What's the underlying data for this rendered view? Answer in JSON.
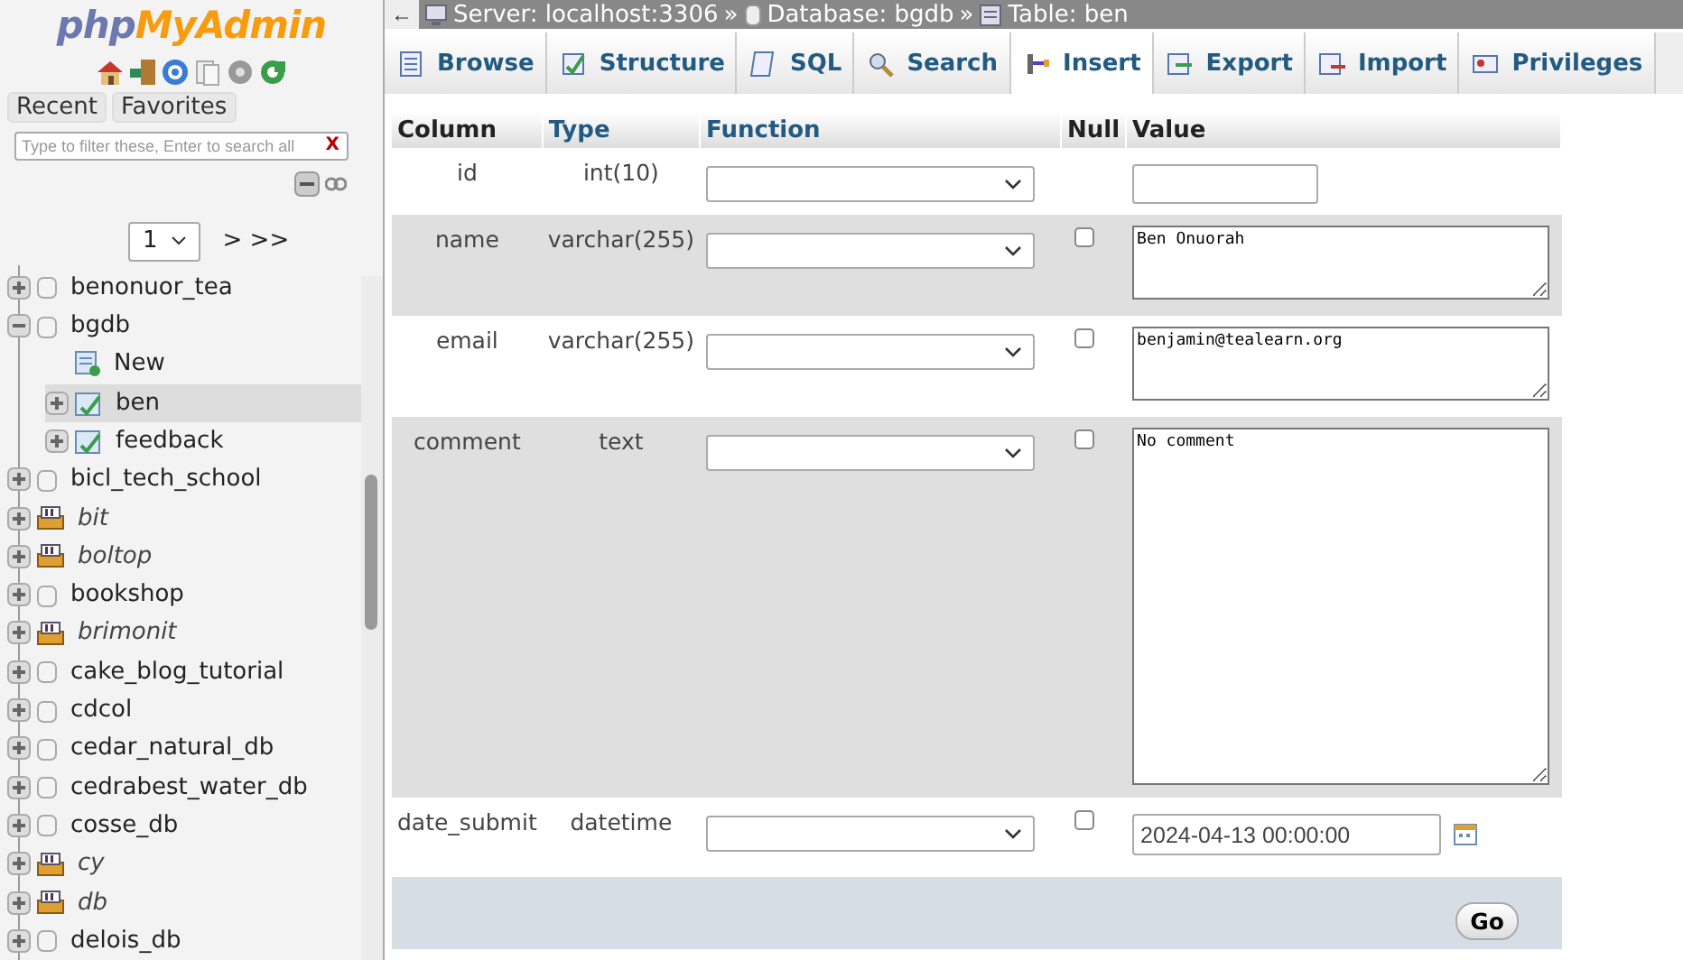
{
  "sidebar": {
    "logo": {
      "prefix": "php",
      "name": "MyAdmin"
    },
    "tabs": [
      {
        "label": "Recent"
      },
      {
        "label": "Favorites"
      }
    ],
    "filter": {
      "placeholder": "Type to filter these, Enter to search all",
      "clear": "X"
    },
    "pager": {
      "page": "1",
      "next": "> >>"
    },
    "tree": [
      {
        "label": "benonuor_tea",
        "kind": "database",
        "expanded": false,
        "selected": false
      },
      {
        "label": "bgdb",
        "kind": "database",
        "expanded": true,
        "selected": false,
        "children": [
          {
            "label": "New",
            "kind": "new",
            "selected": false
          },
          {
            "label": "ben",
            "kind": "table",
            "expanded": false,
            "selected": true
          },
          {
            "label": "feedback",
            "kind": "table",
            "expanded": false,
            "selected": false
          }
        ]
      },
      {
        "label": "bicl_tech_school",
        "kind": "database",
        "expanded": false,
        "selected": false
      },
      {
        "label": "bit",
        "kind": "group",
        "expanded": false,
        "selected": false
      },
      {
        "label": "boltop",
        "kind": "group",
        "expanded": false,
        "selected": false
      },
      {
        "label": "bookshop",
        "kind": "database",
        "expanded": false,
        "selected": false
      },
      {
        "label": "brimonit",
        "kind": "group",
        "expanded": false,
        "selected": false
      },
      {
        "label": "cake_blog_tutorial",
        "kind": "database",
        "expanded": false,
        "selected": false
      },
      {
        "label": "cdcol",
        "kind": "database",
        "expanded": false,
        "selected": false
      },
      {
        "label": "cedar_natural_db",
        "kind": "database",
        "expanded": false,
        "selected": false
      },
      {
        "label": "cedrabest_water_db",
        "kind": "database",
        "expanded": false,
        "selected": false
      },
      {
        "label": "cosse_db",
        "kind": "database",
        "expanded": false,
        "selected": false
      },
      {
        "label": "cy",
        "kind": "group",
        "expanded": false,
        "selected": false
      },
      {
        "label": "db",
        "kind": "group",
        "expanded": false,
        "selected": false
      },
      {
        "label": "delois_db",
        "kind": "database",
        "expanded": false,
        "selected": false
      }
    ]
  },
  "breadcrumb": {
    "back": "←",
    "items": [
      {
        "label": "Server: localhost:3306",
        "kind": "server"
      },
      {
        "label": "Database: bgdb",
        "kind": "database"
      },
      {
        "label": "Table: ben",
        "kind": "table"
      }
    ],
    "separator": "»"
  },
  "tabs": [
    {
      "label": "Browse",
      "selected": false
    },
    {
      "label": "Structure",
      "selected": false
    },
    {
      "label": "SQL",
      "selected": false
    },
    {
      "label": "Search",
      "selected": false
    },
    {
      "label": "Insert",
      "selected": true
    },
    {
      "label": "Export",
      "selected": false
    },
    {
      "label": "Import",
      "selected": false
    },
    {
      "label": "Privileges",
      "selected": false
    }
  ],
  "table": {
    "columns": [
      {
        "label": "Column",
        "link": false
      },
      {
        "label": "Type",
        "link": true
      },
      {
        "label": "Function",
        "link": true
      },
      {
        "label": "Null",
        "link": false
      },
      {
        "label": "Value",
        "link": false
      }
    ],
    "rows": [
      {
        "column": "id",
        "type": "int(10)",
        "kind": "input",
        "value": ""
      },
      {
        "column": "name",
        "type": "varchar(255)",
        "null_checked": false,
        "kind": "textarea",
        "value": "Ben Onuorah"
      },
      {
        "column": "email",
        "type": "varchar(255)",
        "null_checked": false,
        "kind": "textarea",
        "value": "benjamin@tealearn.org"
      },
      {
        "column": "comment",
        "type": "text",
        "null_checked": false,
        "kind": "longtext",
        "value": "No comment"
      },
      {
        "column": "date_submit",
        "type": "datetime",
        "null_checked": false,
        "kind": "date",
        "value": "2024-04-13 00:00:00"
      }
    ]
  },
  "go_button": "Go"
}
